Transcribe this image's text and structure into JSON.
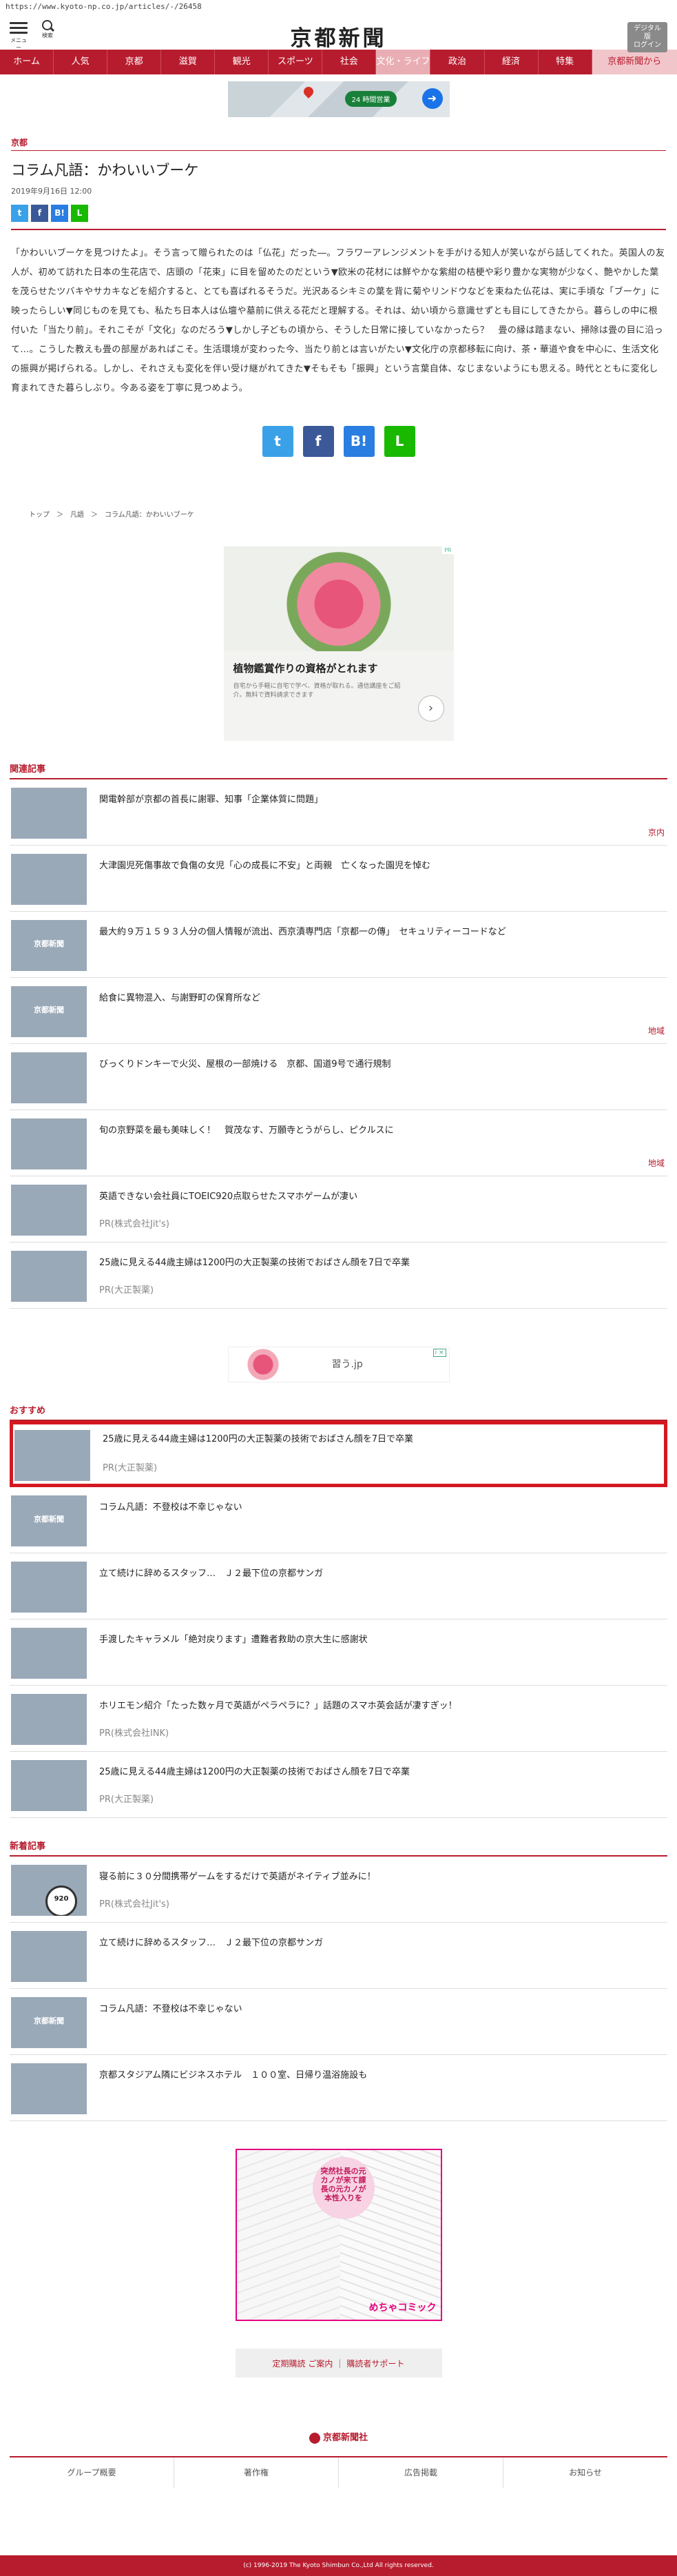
{
  "url": "https://www.kyoto-np.co.jp/articles/-/26458",
  "header": {
    "menu_label": "メニュー",
    "search_label": "検索",
    "logo": "京都新聞",
    "digital_label": "デジタル版\nログイン"
  },
  "nav": [
    "ホーム",
    "人気",
    "京都",
    "滋賀",
    "観光",
    "スポーツ",
    "社会",
    "文化・ライフ",
    "政治",
    "経済",
    "特集",
    "京都新聞から"
  ],
  "nav_active": "文化・ライフ",
  "ad_top": {
    "pill": "24 時間営業"
  },
  "article": {
    "category": "京都",
    "title": "コラム凡語：かわいいブーケ",
    "date": "2019年9月16日 12:00",
    "share_small": [
      "t",
      "f",
      "B!",
      "L"
    ],
    "body": "「かわいいブーケを見つけたよ」。そう言って贈られたのは「仏花」だった―。フラワーアレンジメントを手がける知人が笑いながら話してくれた。英国人の友人が、初めて訪れた日本の生花店で、店頭の「花束」に目を留めたのだという▼欧米の花材には鮮やかな紫紺の桔梗や彩り豊かな実物が少なく、艶やかした葉を茂らせたツバキやサカキなどを紹介すると、とても喜ばれるそうだ。光沢あるシキミの葉を背に菊やリンドウなどを束ねた仏花は、実に手頃な「ブーケ」に映ったらしい▼同じものを見ても、私たち日本人は仏壇や墓前に供える花だと理解する。それは、幼い頃から意識せずとも目にしてきたから。暮らしの中に根付いた「当たり前」。それこそが「文化」なのだろう▼しかし子どもの頃から、そうした日常に接していなかったら？　畳の縁は踏まない、掃除は畳の目に沿って…。こうした教えも畳の部屋があればこそ。生活環境が変わった今、当たり前とは言いがたい▼文化庁の京都移転に向け、茶・華道や食を中心に、生活文化の振興が掲げられる。しかし、それさえも変化を伴い受け継がれてきた▼そもそも「振興」という言葉自体、なじまないようにも思える。時代とともに変化し育まれてきた暮らしぶり。今ある姿を丁寧に見つめよう。",
    "share_big": [
      "t",
      "f",
      "B!",
      "L"
    ]
  },
  "breadcrumb": "トップ　＞　凡語　＞　コラム凡語：かわいいブーケ",
  "ad_square": {
    "title": "植物鑑賞作りの資格がとれます",
    "desc": "自宅から手軽に自宅で学べ、資格が取れる。通信講座をご紹介。無料で資料請求できます",
    "tag": "PR"
  },
  "related": {
    "heading": "関連記事",
    "items": [
      {
        "headline": "関電幹部が京都の首長に謝罪、知事「企業体質に問題」",
        "region": "京内",
        "pr": "",
        "thumb": "t-mtn",
        "logo": ""
      },
      {
        "headline": "大津園児死傷事故で負傷の女児「心の成長に不安」と両親　亡くなった園児を悼む",
        "region": "",
        "pr": "",
        "thumb": "t-dark",
        "logo": ""
      },
      {
        "headline": "最大約９万１５９３人分の個人情報が流出、西京漬専門店「京都一の傳」　セキュリティーコードなど",
        "region": "",
        "pr": "",
        "thumb": "t-blue",
        "logo": "京都新聞"
      },
      {
        "headline": "給食に異物混入、与謝野町の保育所など",
        "region": "地域",
        "pr": "",
        "thumb": "t-blue",
        "logo": "京都新聞"
      },
      {
        "headline": "びっくりドンキーで火災、屋根の一部焼ける　京都、国道9号で通行規制",
        "region": "",
        "pr": "",
        "thumb": "t-house",
        "logo": ""
      },
      {
        "headline": "旬の京野菜を最も美味しく！　賀茂なす、万願寺とうがらし、ピクルスに",
        "region": "地域",
        "pr": "",
        "thumb": "t-food",
        "logo": ""
      },
      {
        "headline": "英語できない会社員にTOEIC920点取らせたスマホゲームが凄い",
        "region": "",
        "pr": "PR(株式会社Jit's)",
        "thumb": "t-man",
        "logo": ""
      },
      {
        "headline": "25歳に見える44歳主婦は1200円の大正製薬の技術でおばさん顔を7日で卒業",
        "region": "",
        "pr": "PR(大正製薬)",
        "thumb": "t-woman",
        "logo": ""
      }
    ]
  },
  "ad_mid": {
    "text": "習う.jp",
    "tag": "i ×"
  },
  "recommended": {
    "heading": "おすすめ",
    "items": [
      {
        "headline": "25歳に見える44歳主婦は1200円の大正製薬の技術でおばさん顔を7日で卒業",
        "pr": "PR(大正製薬)",
        "thumb": "t-woman",
        "logo": ""
      },
      {
        "headline": "コラム凡語：不登校は不幸じゃない",
        "pr": "",
        "thumb": "t-blue",
        "logo": "京都新聞"
      },
      {
        "headline": "立て続けに辞めるスタッフ…　Ｊ２最下位の京都サンガ",
        "pr": "",
        "thumb": "t-crowd",
        "logo": ""
      },
      {
        "headline": "手渡したキャラメル「絶対戻ります」遭難者救助の京大生に感謝状",
        "pr": "",
        "thumb": "t-dessert",
        "logo": ""
      },
      {
        "headline": "ホリエモン紹介「たった数ヶ月で英語がペラペラに？」話題のスマホ英会話が凄すぎッ！",
        "pr": "PR(株式会社INK)",
        "thumb": "t-horie",
        "logo": ""
      },
      {
        "headline": "25歳に見える44歳主婦は1200円の大正製薬の技術でおばさん顔を7日で卒業",
        "pr": "PR(大正製薬)",
        "thumb": "t-woman",
        "logo": ""
      }
    ]
  },
  "latest": {
    "heading": "新着記事",
    "items": [
      {
        "headline": "寝る前に３０分間携帯ゲームをするだけで英語がネイティブ並みに！",
        "pr": "PR(株式会社Jit's)",
        "thumb": "t-pr",
        "logo": ""
      },
      {
        "headline": "立て続けに辞めるスタッフ…　Ｊ２最下位の京都サンガ",
        "pr": "",
        "thumb": "t-crowd",
        "logo": ""
      },
      {
        "headline": "コラム凡語：不登校は不幸じゃない",
        "pr": "",
        "thumb": "t-blue",
        "logo": "京都新聞"
      },
      {
        "headline": "京都スタジアム隣にビジネスホテル　１００室、日帰り温浴施設も",
        "pr": "",
        "thumb": "t-stadium",
        "logo": ""
      }
    ]
  },
  "manga_ad": {
    "bubble": "突然社長の元カノが来て課長の元カノが本性入りを",
    "brand": "めちゃコミック"
  },
  "subscription": {
    "link1": "定期購読 ご案内",
    "sep": "|",
    "link2": "購読者サポート"
  },
  "footer": {
    "logo": "京都新聞社",
    "links": [
      "グループ概要",
      "著作権",
      "広告掲載",
      "お知らせ"
    ],
    "copyright": "(c) 1996-2019 The Kyoto Shimbun Co.,Ltd All rights reserved."
  }
}
